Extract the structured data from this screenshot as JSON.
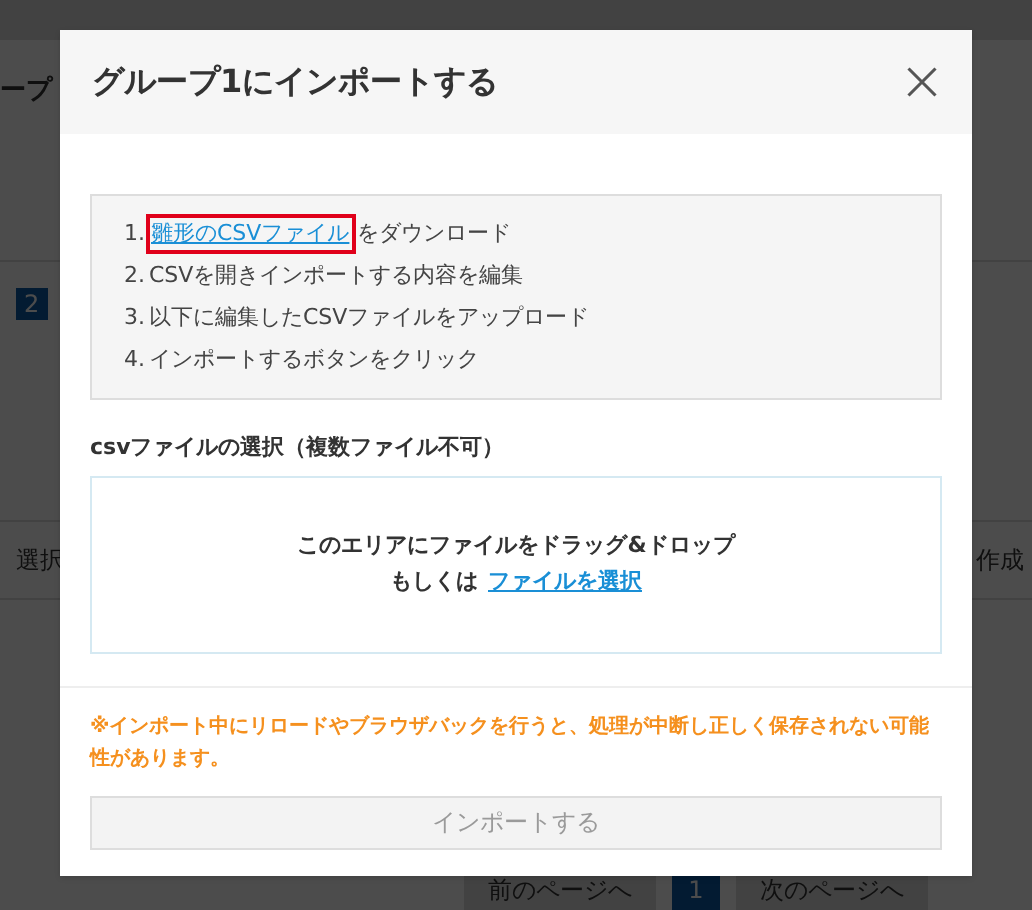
{
  "background_page": {
    "title": "ープ",
    "badge": "2",
    "column_1": "選択",
    "column_2": "作成",
    "pagination": {
      "previous": "前のページへ",
      "page": "1",
      "next": "次のページへ"
    }
  },
  "dialog": {
    "title": "グループ1にインポートする",
    "steps": [
      {
        "number": "1.",
        "link": "雛形のCSVファイル",
        "link_highlighted": true,
        "text": "をダウンロード"
      },
      {
        "number": "2.",
        "text": "CSVを開きインポートする内容を編集"
      },
      {
        "number": "3.",
        "text": "以下に編集したCSVファイルをアップロード"
      },
      {
        "number": "4.",
        "text": "インポートするボタンをクリック"
      }
    ],
    "file_label": "csvファイルの選択（複数ファイル不可）",
    "dropzone": {
      "line_1": "このエリアにファイルをドラッグ&ドロップ",
      "prefix": "もしくは",
      "link": "ファイルを選択"
    },
    "warning": "※インポート中にリロードやブラウザバックを行うと、処理が中断し正しく保存されない可能性があります。",
    "import_button": {
      "label": "インポートする",
      "disabled": true
    }
  }
}
